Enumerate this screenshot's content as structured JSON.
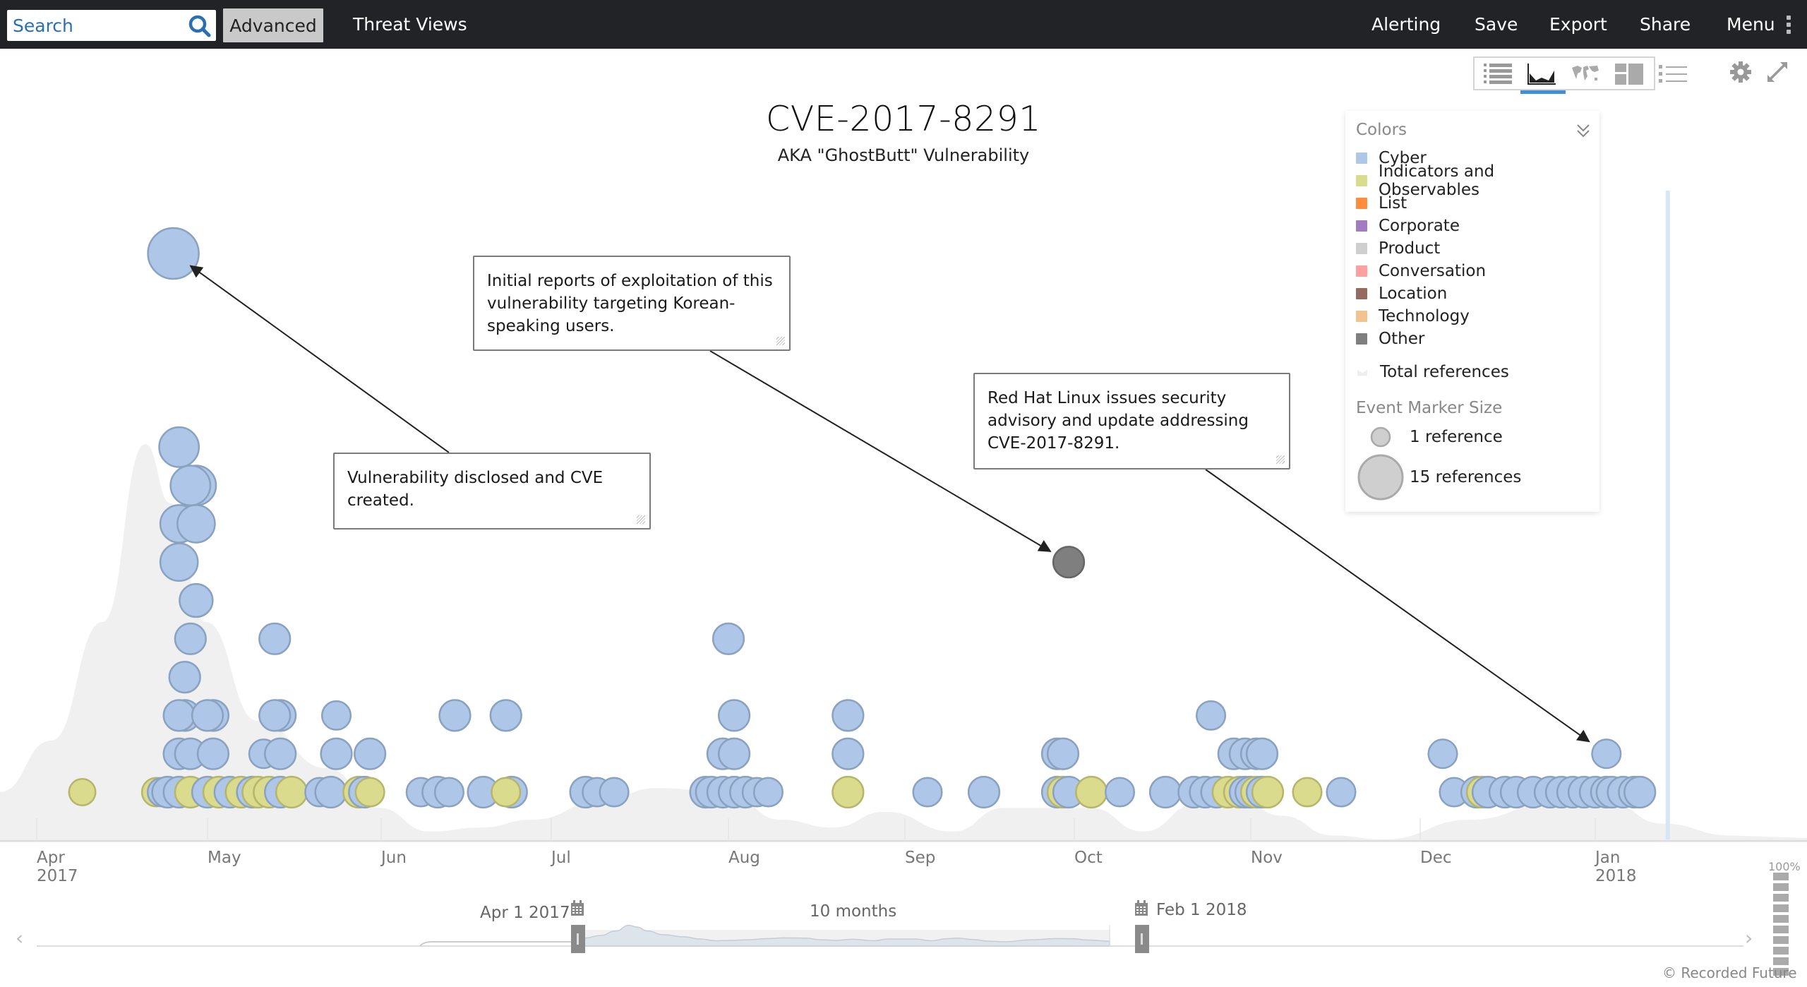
{
  "topbar": {
    "search_placeholder": "Search",
    "advanced_label": "Advanced",
    "threat_views_label": "Threat Views",
    "alerting_label": "Alerting",
    "save_label": "Save",
    "export_label": "Export",
    "share_label": "Share",
    "menu_label": "Menu"
  },
  "view_switcher": {
    "items": [
      {
        "icon": "table-list-icon",
        "label": "Table view"
      },
      {
        "icon": "timeline-chart-icon",
        "label": "Timeline view",
        "active": true
      },
      {
        "icon": "world-map-icon",
        "label": "Map view"
      },
      {
        "icon": "dashboard-layout-icon",
        "label": "Layout view"
      },
      {
        "icon": "bullet-list-icon",
        "label": "List view"
      }
    ],
    "settings_icon": "gear-icon",
    "fullscreen_icon": "expand-icon"
  },
  "header": {
    "title": "CVE-2017-8291",
    "subtitle": "AKA \"GhostButt\" Vulnerability"
  },
  "annotations": [
    {
      "text": "Vulnerability disclosed and CVE created."
    },
    {
      "text": "Initial reports of exploitation of this vulnerability targeting Korean-speaking users."
    },
    {
      "text": "Red Hat Linux issues security advisory and update addressing CVE-2017-8291."
    }
  ],
  "legend": {
    "colors_title": "Colors",
    "categories": [
      {
        "name": "Cyber",
        "color": "#aec7e8"
      },
      {
        "name": "Indicators and Observables",
        "color": "#dbdb8d"
      },
      {
        "name": "List",
        "color": "#ff8c3a"
      },
      {
        "name": "Corporate",
        "color": "#a17cc0"
      },
      {
        "name": "Product",
        "color": "#cfcfcf"
      },
      {
        "name": "Conversation",
        "color": "#ffa0a0"
      },
      {
        "name": "Location",
        "color": "#966a5e"
      },
      {
        "name": "Technology",
        "color": "#f1c38e"
      },
      {
        "name": "Other",
        "color": "#7f7f7f"
      }
    ],
    "total_references_label": "Total references",
    "marker_size_title": "Event Marker Size",
    "size_small_label": "1 reference",
    "size_large_label": "15 references"
  },
  "time_range": {
    "start_label": "Apr 1 2017",
    "end_label": "Feb 1 2018",
    "duration_label": "10 months",
    "zoom_level": "100%"
  },
  "footer": {
    "copyright": "© Recorded Future"
  },
  "chart_data": {
    "type": "scatter",
    "title": "CVE-2017-8291",
    "subtitle": "AKA \"GhostButt\" Vulnerability",
    "x_axis": {
      "type": "time",
      "range": [
        "2017-04-01",
        "2018-02-01"
      ],
      "ticks": [
        {
          "label": "Apr",
          "sub": "2017"
        },
        {
          "label": "May"
        },
        {
          "label": "Jun"
        },
        {
          "label": "Jul"
        },
        {
          "label": "Aug"
        },
        {
          "label": "Sep"
        },
        {
          "label": "Oct"
        },
        {
          "label": "Nov"
        },
        {
          "label": "Dec"
        },
        {
          "label": "Jan",
          "sub": "2018"
        }
      ]
    },
    "legend_position": "top-right",
    "background_area": {
      "name": "Total references",
      "values_by_month_fraction": [
        [
          0,
          0.12
        ],
        [
          0.3,
          0.25
        ],
        [
          0.6,
          0.55
        ],
        [
          0.85,
          1.0
        ],
        [
          1.0,
          0.85
        ],
        [
          1.2,
          0.55
        ],
        [
          1.5,
          0.3
        ],
        [
          1.9,
          0.18
        ],
        [
          2.2,
          0.08
        ],
        [
          2.5,
          0.02
        ],
        [
          2.8,
          0.03
        ],
        [
          3.1,
          0.05
        ],
        [
          3.5,
          0.1
        ],
        [
          3.8,
          0.13
        ],
        [
          4.2,
          0.12
        ],
        [
          4.5,
          0.05
        ],
        [
          4.8,
          0.03
        ],
        [
          5.1,
          0.07
        ],
        [
          5.5,
          0.02
        ],
        [
          5.8,
          0.08
        ],
        [
          6.3,
          0.08
        ],
        [
          6.6,
          0.02
        ],
        [
          6.9,
          0.09
        ],
        [
          7.1,
          0.12
        ],
        [
          7.4,
          0.06
        ],
        [
          7.7,
          0.01
        ],
        [
          8.0,
          0.0
        ],
        [
          8.5,
          0.05
        ],
        [
          9.0,
          0.1
        ],
        [
          9.3,
          0.09
        ],
        [
          9.6,
          0.04
        ],
        [
          10.0,
          0.01
        ]
      ]
    },
    "events": [
      {
        "date": "2017-04-25",
        "row": 14,
        "category": "Cyber",
        "refs": 15
      },
      {
        "date": "2017-04-26",
        "row": 9,
        "category": "Cyber",
        "refs": 10
      },
      {
        "date": "2017-04-29",
        "row": 8,
        "category": "Cyber",
        "refs": 10
      },
      {
        "date": "2017-04-28",
        "row": 8,
        "category": "Cyber",
        "refs": 10
      },
      {
        "date": "2017-04-26",
        "row": 7,
        "category": "Cyber",
        "refs": 9
      },
      {
        "date": "2017-04-29",
        "row": 7,
        "category": "Cyber",
        "refs": 9
      },
      {
        "date": "2017-04-26",
        "row": 6,
        "category": "Cyber",
        "refs": 9
      },
      {
        "date": "2017-04-29",
        "row": 5,
        "category": "Cyber",
        "refs": 7
      },
      {
        "date": "2017-04-28",
        "row": 4,
        "category": "Cyber",
        "refs": 6
      },
      {
        "date": "2017-04-27",
        "row": 3,
        "category": "Cyber",
        "refs": 6
      },
      {
        "date": "2017-05-13",
        "row": 4,
        "category": "Cyber",
        "refs": 6
      },
      {
        "date": "2017-04-27",
        "row": 2,
        "category": "Cyber",
        "refs": 6
      },
      {
        "date": "2017-04-26",
        "row": 2,
        "category": "Cyber",
        "refs": 6
      },
      {
        "date": "2017-05-02",
        "row": 2,
        "category": "Cyber",
        "refs": 6
      },
      {
        "date": "2017-05-01",
        "row": 2,
        "category": "Cyber",
        "refs": 6
      },
      {
        "date": "2017-05-14",
        "row": 2,
        "category": "Cyber",
        "refs": 6
      },
      {
        "date": "2017-05-13",
        "row": 2,
        "category": "Cyber",
        "refs": 6
      },
      {
        "date": "2017-05-24",
        "row": 2,
        "category": "Cyber",
        "refs": 5
      },
      {
        "date": "2017-06-14",
        "row": 2,
        "category": "Cyber",
        "refs": 6
      },
      {
        "date": "2017-06-23",
        "row": 2,
        "category": "Cyber",
        "refs": 6
      },
      {
        "date": "2017-08-01",
        "row": 4,
        "category": "Cyber",
        "refs": 6
      },
      {
        "date": "2017-08-02",
        "row": 2,
        "category": "Cyber",
        "refs": 6
      },
      {
        "date": "2017-08-22",
        "row": 2,
        "category": "Cyber",
        "refs": 6
      },
      {
        "date": "2017-10-25",
        "row": 2,
        "category": "Cyber",
        "refs": 5
      },
      {
        "date": "2017-04-26",
        "row": 1,
        "category": "Cyber",
        "refs": 6
      },
      {
        "date": "2017-04-28",
        "row": 1,
        "category": "Cyber",
        "refs": 6
      },
      {
        "date": "2017-05-02",
        "row": 1,
        "category": "Cyber",
        "refs": 6
      },
      {
        "date": "2017-05-11",
        "row": 1,
        "category": "Cyber",
        "refs": 5
      },
      {
        "date": "2017-05-14",
        "row": 1,
        "category": "Cyber",
        "refs": 6
      },
      {
        "date": "2017-05-24",
        "row": 1,
        "category": "Cyber",
        "refs": 6
      },
      {
        "date": "2017-05-30",
        "row": 1,
        "category": "Cyber",
        "refs": 6
      },
      {
        "date": "2017-07-31",
        "row": 1,
        "category": "Cyber",
        "refs": 6
      },
      {
        "date": "2017-08-02",
        "row": 1,
        "category": "Cyber",
        "refs": 6
      },
      {
        "date": "2017-08-22",
        "row": 1,
        "category": "Cyber",
        "refs": 6
      },
      {
        "date": "2017-09-28",
        "row": 1,
        "category": "Cyber",
        "refs": 6
      },
      {
        "date": "2017-09-29",
        "row": 1,
        "category": "Cyber",
        "refs": 6
      },
      {
        "date": "2017-10-29",
        "row": 1,
        "category": "Cyber",
        "refs": 6
      },
      {
        "date": "2017-10-31",
        "row": 1,
        "category": "Cyber",
        "refs": 6
      },
      {
        "date": "2017-11-02",
        "row": 1,
        "category": "Cyber",
        "refs": 6
      },
      {
        "date": "2017-11-03",
        "row": 1,
        "category": "Cyber",
        "refs": 6
      },
      {
        "date": "2017-12-05",
        "row": 1,
        "category": "Cyber",
        "refs": 5
      },
      {
        "date": "2018-01-03",
        "row": 1,
        "category": "Cyber",
        "refs": 5
      },
      {
        "date": "2017-09-30",
        "row": 6,
        "category": "Other",
        "refs": 6
      },
      {
        "date": "2017-04-09",
        "row": 0,
        "category": "Indicators and Observables",
        "refs": 4
      },
      {
        "date": "2017-04-22",
        "row": 0,
        "category": "Indicators and Observables",
        "refs": 5
      },
      {
        "date": "2017-04-23",
        "row": 0,
        "category": "Cyber",
        "refs": 5
      },
      {
        "date": "2017-04-24",
        "row": 0,
        "category": "Cyber",
        "refs": 6
      },
      {
        "date": "2017-04-26",
        "row": 0,
        "category": "Cyber",
        "refs": 6
      },
      {
        "date": "2017-04-28",
        "row": 0,
        "category": "Indicators and Observables",
        "refs": 6
      },
      {
        "date": "2017-05-01",
        "row": 0,
        "category": "Cyber",
        "refs": 6
      },
      {
        "date": "2017-05-03",
        "row": 0,
        "category": "Indicators and Observables",
        "refs": 6
      },
      {
        "date": "2017-05-05",
        "row": 0,
        "category": "Cyber",
        "refs": 6
      },
      {
        "date": "2017-05-07",
        "row": 0,
        "category": "Indicators and Observables",
        "refs": 6
      },
      {
        "date": "2017-05-09",
        "row": 0,
        "category": "Cyber",
        "refs": 6
      },
      {
        "date": "2017-05-10",
        "row": 0,
        "category": "Indicators and Observables",
        "refs": 6
      },
      {
        "date": "2017-05-12",
        "row": 0,
        "category": "Indicators and Observables",
        "refs": 6
      },
      {
        "date": "2017-05-14",
        "row": 0,
        "category": "Cyber",
        "refs": 6
      },
      {
        "date": "2017-05-16",
        "row": 0,
        "category": "Indicators and Observables",
        "refs": 6
      },
      {
        "date": "2017-05-21",
        "row": 0,
        "category": "Cyber",
        "refs": 5
      },
      {
        "date": "2017-05-23",
        "row": 0,
        "category": "Cyber",
        "refs": 6
      },
      {
        "date": "2017-05-28",
        "row": 0,
        "category": "Indicators and Observables",
        "refs": 6
      },
      {
        "date": "2017-05-29",
        "row": 0,
        "category": "Cyber",
        "refs": 6
      },
      {
        "date": "2017-05-30",
        "row": 0,
        "category": "Indicators and Observables",
        "refs": 5
      },
      {
        "date": "2017-06-08",
        "row": 0,
        "category": "Cyber",
        "refs": 5
      },
      {
        "date": "2017-06-11",
        "row": 0,
        "category": "Cyber",
        "refs": 6
      },
      {
        "date": "2017-06-13",
        "row": 0,
        "category": "Cyber",
        "refs": 5
      },
      {
        "date": "2017-06-19",
        "row": 0,
        "category": "Cyber",
        "refs": 6
      },
      {
        "date": "2017-06-24",
        "row": 0,
        "category": "Cyber",
        "refs": 6
      },
      {
        "date": "2017-06-23",
        "row": 0,
        "category": "Indicators and Observables",
        "refs": 5
      },
      {
        "date": "2017-07-07",
        "row": 0,
        "category": "Cyber",
        "refs": 6
      },
      {
        "date": "2017-07-09",
        "row": 0,
        "category": "Cyber",
        "refs": 5
      },
      {
        "date": "2017-07-12",
        "row": 0,
        "category": "Cyber",
        "refs": 5
      },
      {
        "date": "2017-07-28",
        "row": 0,
        "category": "Cyber",
        "refs": 6
      },
      {
        "date": "2017-07-29",
        "row": 0,
        "category": "Cyber",
        "refs": 6
      },
      {
        "date": "2017-07-31",
        "row": 0,
        "category": "Cyber",
        "refs": 6
      },
      {
        "date": "2017-08-02",
        "row": 0,
        "category": "Cyber",
        "refs": 6
      },
      {
        "date": "2017-08-04",
        "row": 0,
        "category": "Cyber",
        "refs": 6
      },
      {
        "date": "2017-08-06",
        "row": 0,
        "category": "Cyber",
        "refs": 5
      },
      {
        "date": "2017-08-08",
        "row": 0,
        "category": "Cyber",
        "refs": 5
      },
      {
        "date": "2017-08-22",
        "row": 0,
        "category": "Indicators and Observables",
        "refs": 6
      },
      {
        "date": "2017-09-05",
        "row": 0,
        "category": "Cyber",
        "refs": 5
      },
      {
        "date": "2017-09-15",
        "row": 0,
        "category": "Cyber",
        "refs": 6
      },
      {
        "date": "2017-09-28",
        "row": 0,
        "category": "Cyber",
        "refs": 6
      },
      {
        "date": "2017-09-29",
        "row": 0,
        "category": "Indicators and Observables",
        "refs": 6
      },
      {
        "date": "2017-09-30",
        "row": 0,
        "category": "Cyber",
        "refs": 6
      },
      {
        "date": "2017-10-04",
        "row": 0,
        "category": "Indicators and Observables",
        "refs": 6
      },
      {
        "date": "2017-10-09",
        "row": 0,
        "category": "Cyber",
        "refs": 5
      },
      {
        "date": "2017-10-17",
        "row": 0,
        "category": "Cyber",
        "refs": 6
      },
      {
        "date": "2017-10-22",
        "row": 0,
        "category": "Cyber",
        "refs": 6
      },
      {
        "date": "2017-10-24",
        "row": 0,
        "category": "Cyber",
        "refs": 6
      },
      {
        "date": "2017-10-26",
        "row": 0,
        "category": "Cyber",
        "refs": 6
      },
      {
        "date": "2017-10-28",
        "row": 0,
        "category": "Indicators and Observables",
        "refs": 6
      },
      {
        "date": "2017-10-30",
        "row": 0,
        "category": "Indicators and Observables",
        "refs": 6
      },
      {
        "date": "2017-10-31",
        "row": 0,
        "category": "Cyber",
        "refs": 6
      },
      {
        "date": "2017-11-01",
        "row": 0,
        "category": "Cyber",
        "refs": 6
      },
      {
        "date": "2017-11-02",
        "row": 0,
        "category": "Indicators and Observables",
        "refs": 6
      },
      {
        "date": "2017-11-03",
        "row": 0,
        "category": "Cyber",
        "refs": 6
      },
      {
        "date": "2017-11-04",
        "row": 0,
        "category": "Indicators and Observables",
        "refs": 6
      },
      {
        "date": "2017-11-11",
        "row": 0,
        "category": "Indicators and Observables",
        "refs": 5
      },
      {
        "date": "2017-11-17",
        "row": 0,
        "category": "Cyber",
        "refs": 5
      },
      {
        "date": "2017-12-07",
        "row": 0,
        "category": "Cyber",
        "refs": 5
      },
      {
        "date": "2017-12-11",
        "row": 0,
        "category": "Cyber",
        "refs": 6
      },
      {
        "date": "2017-12-12",
        "row": 0,
        "category": "Indicators and Observables",
        "refs": 6
      },
      {
        "date": "2017-12-13",
        "row": 0,
        "category": "Cyber",
        "refs": 6
      },
      {
        "date": "2017-12-16",
        "row": 0,
        "category": "Cyber",
        "refs": 6
      },
      {
        "date": "2017-12-18",
        "row": 0,
        "category": "Cyber",
        "refs": 6
      },
      {
        "date": "2017-12-21",
        "row": 0,
        "category": "Cyber",
        "refs": 6
      },
      {
        "date": "2017-12-24",
        "row": 0,
        "category": "Cyber",
        "refs": 6
      },
      {
        "date": "2017-12-26",
        "row": 0,
        "category": "Cyber",
        "refs": 6
      },
      {
        "date": "2017-12-28",
        "row": 0,
        "category": "Cyber",
        "refs": 6
      },
      {
        "date": "2017-12-30",
        "row": 0,
        "category": "Cyber",
        "refs": 6
      },
      {
        "date": "2018-01-01",
        "row": 0,
        "category": "Cyber",
        "refs": 6
      },
      {
        "date": "2018-01-03",
        "row": 0,
        "category": "Cyber",
        "refs": 6
      },
      {
        "date": "2018-01-04",
        "row": 0,
        "category": "Cyber",
        "refs": 6
      },
      {
        "date": "2018-01-06",
        "row": 0,
        "category": "Cyber",
        "refs": 6
      },
      {
        "date": "2018-01-08",
        "row": 0,
        "category": "Cyber",
        "refs": 6
      },
      {
        "date": "2018-01-09",
        "row": 0,
        "category": "Cyber",
        "refs": 6
      }
    ],
    "annotation_targets": [
      {
        "annotation": 0,
        "date": "2017-04-25",
        "row": 14
      },
      {
        "annotation": 1,
        "date": "2017-09-30",
        "row": 6
      },
      {
        "annotation": 2,
        "date": "2018-01-03",
        "row": 1
      }
    ],
    "current_date_marker": "2018-01-14"
  }
}
